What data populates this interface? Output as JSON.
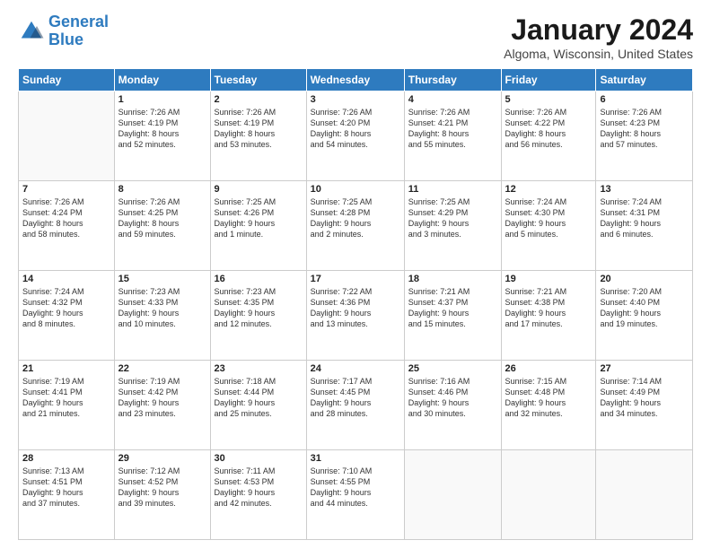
{
  "header": {
    "logo_line1": "General",
    "logo_line2": "Blue",
    "month_title": "January 2024",
    "location": "Algoma, Wisconsin, United States"
  },
  "days_of_week": [
    "Sunday",
    "Monday",
    "Tuesday",
    "Wednesday",
    "Thursday",
    "Friday",
    "Saturday"
  ],
  "weeks": [
    [
      {
        "day": "",
        "content": ""
      },
      {
        "day": "1",
        "content": "Sunrise: 7:26 AM\nSunset: 4:19 PM\nDaylight: 8 hours\nand 52 minutes."
      },
      {
        "day": "2",
        "content": "Sunrise: 7:26 AM\nSunset: 4:19 PM\nDaylight: 8 hours\nand 53 minutes."
      },
      {
        "day": "3",
        "content": "Sunrise: 7:26 AM\nSunset: 4:20 PM\nDaylight: 8 hours\nand 54 minutes."
      },
      {
        "day": "4",
        "content": "Sunrise: 7:26 AM\nSunset: 4:21 PM\nDaylight: 8 hours\nand 55 minutes."
      },
      {
        "day": "5",
        "content": "Sunrise: 7:26 AM\nSunset: 4:22 PM\nDaylight: 8 hours\nand 56 minutes."
      },
      {
        "day": "6",
        "content": "Sunrise: 7:26 AM\nSunset: 4:23 PM\nDaylight: 8 hours\nand 57 minutes."
      }
    ],
    [
      {
        "day": "7",
        "content": "Sunrise: 7:26 AM\nSunset: 4:24 PM\nDaylight: 8 hours\nand 58 minutes."
      },
      {
        "day": "8",
        "content": "Sunrise: 7:26 AM\nSunset: 4:25 PM\nDaylight: 8 hours\nand 59 minutes."
      },
      {
        "day": "9",
        "content": "Sunrise: 7:25 AM\nSunset: 4:26 PM\nDaylight: 9 hours\nand 1 minute."
      },
      {
        "day": "10",
        "content": "Sunrise: 7:25 AM\nSunset: 4:28 PM\nDaylight: 9 hours\nand 2 minutes."
      },
      {
        "day": "11",
        "content": "Sunrise: 7:25 AM\nSunset: 4:29 PM\nDaylight: 9 hours\nand 3 minutes."
      },
      {
        "day": "12",
        "content": "Sunrise: 7:24 AM\nSunset: 4:30 PM\nDaylight: 9 hours\nand 5 minutes."
      },
      {
        "day": "13",
        "content": "Sunrise: 7:24 AM\nSunset: 4:31 PM\nDaylight: 9 hours\nand 6 minutes."
      }
    ],
    [
      {
        "day": "14",
        "content": "Sunrise: 7:24 AM\nSunset: 4:32 PM\nDaylight: 9 hours\nand 8 minutes."
      },
      {
        "day": "15",
        "content": "Sunrise: 7:23 AM\nSunset: 4:33 PM\nDaylight: 9 hours\nand 10 minutes."
      },
      {
        "day": "16",
        "content": "Sunrise: 7:23 AM\nSunset: 4:35 PM\nDaylight: 9 hours\nand 12 minutes."
      },
      {
        "day": "17",
        "content": "Sunrise: 7:22 AM\nSunset: 4:36 PM\nDaylight: 9 hours\nand 13 minutes."
      },
      {
        "day": "18",
        "content": "Sunrise: 7:21 AM\nSunset: 4:37 PM\nDaylight: 9 hours\nand 15 minutes."
      },
      {
        "day": "19",
        "content": "Sunrise: 7:21 AM\nSunset: 4:38 PM\nDaylight: 9 hours\nand 17 minutes."
      },
      {
        "day": "20",
        "content": "Sunrise: 7:20 AM\nSunset: 4:40 PM\nDaylight: 9 hours\nand 19 minutes."
      }
    ],
    [
      {
        "day": "21",
        "content": "Sunrise: 7:19 AM\nSunset: 4:41 PM\nDaylight: 9 hours\nand 21 minutes."
      },
      {
        "day": "22",
        "content": "Sunrise: 7:19 AM\nSunset: 4:42 PM\nDaylight: 9 hours\nand 23 minutes."
      },
      {
        "day": "23",
        "content": "Sunrise: 7:18 AM\nSunset: 4:44 PM\nDaylight: 9 hours\nand 25 minutes."
      },
      {
        "day": "24",
        "content": "Sunrise: 7:17 AM\nSunset: 4:45 PM\nDaylight: 9 hours\nand 28 minutes."
      },
      {
        "day": "25",
        "content": "Sunrise: 7:16 AM\nSunset: 4:46 PM\nDaylight: 9 hours\nand 30 minutes."
      },
      {
        "day": "26",
        "content": "Sunrise: 7:15 AM\nSunset: 4:48 PM\nDaylight: 9 hours\nand 32 minutes."
      },
      {
        "day": "27",
        "content": "Sunrise: 7:14 AM\nSunset: 4:49 PM\nDaylight: 9 hours\nand 34 minutes."
      }
    ],
    [
      {
        "day": "28",
        "content": "Sunrise: 7:13 AM\nSunset: 4:51 PM\nDaylight: 9 hours\nand 37 minutes."
      },
      {
        "day": "29",
        "content": "Sunrise: 7:12 AM\nSunset: 4:52 PM\nDaylight: 9 hours\nand 39 minutes."
      },
      {
        "day": "30",
        "content": "Sunrise: 7:11 AM\nSunset: 4:53 PM\nDaylight: 9 hours\nand 42 minutes."
      },
      {
        "day": "31",
        "content": "Sunrise: 7:10 AM\nSunset: 4:55 PM\nDaylight: 9 hours\nand 44 minutes."
      },
      {
        "day": "",
        "content": ""
      },
      {
        "day": "",
        "content": ""
      },
      {
        "day": "",
        "content": ""
      }
    ]
  ]
}
